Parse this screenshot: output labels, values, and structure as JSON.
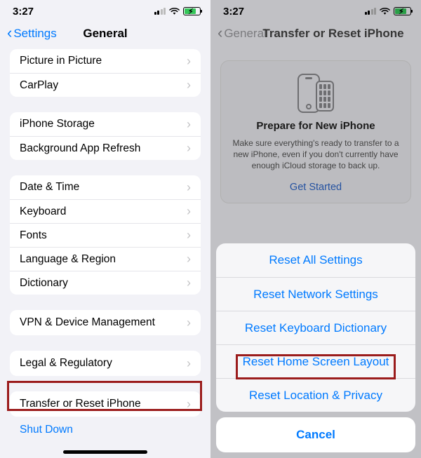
{
  "status": {
    "time": "3:27"
  },
  "left": {
    "back_label": "Settings",
    "title": "General",
    "group1": [
      "Picture in Picture",
      "CarPlay"
    ],
    "group2": [
      "iPhone Storage",
      "Background App Refresh"
    ],
    "group3": [
      "Date & Time",
      "Keyboard",
      "Fonts",
      "Language & Region",
      "Dictionary"
    ],
    "group4": [
      "VPN & Device Management"
    ],
    "group5": [
      "Legal & Regulatory"
    ],
    "group6": [
      "Transfer or Reset iPhone"
    ],
    "shutdown": "Shut Down"
  },
  "right": {
    "back_label": "General",
    "title": "Transfer or Reset iPhone",
    "card_title": "Prepare for New iPhone",
    "card_sub": "Make sure everything's ready to transfer to a new iPhone, even if you don't currently have enough iCloud storage to back up.",
    "card_link": "Get Started",
    "actions": [
      "Reset All Settings",
      "Reset Network Settings",
      "Reset Keyboard Dictionary",
      "Reset Home Screen Layout",
      "Reset Location & Privacy"
    ],
    "cancel": "Cancel"
  }
}
